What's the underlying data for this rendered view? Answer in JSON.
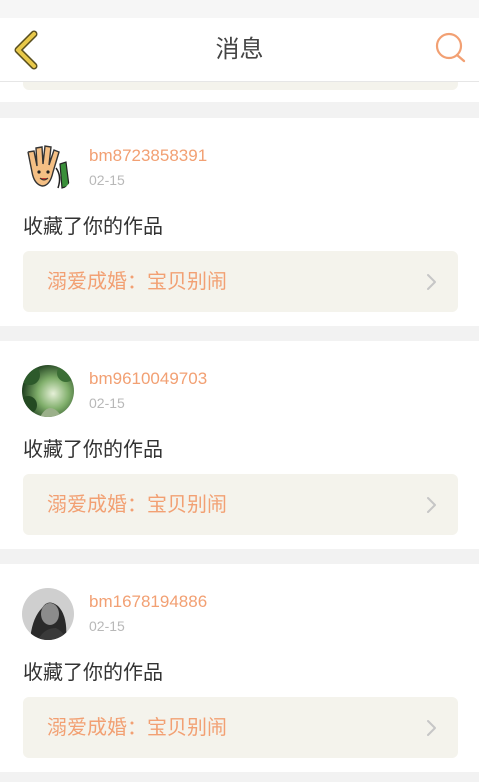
{
  "header": {
    "title": "消息",
    "back_icon": "chevron-left-icon",
    "search_icon": "search-icon",
    "accent_color": "#f2a073",
    "back_color": "#e8c84a"
  },
  "messages": [
    {
      "username": "bm8723858391",
      "date": "02-15",
      "action": "收藏了你的作品",
      "work_title": "溺爱成婚：宝贝别闹"
    },
    {
      "username": "bm9610049703",
      "date": "02-15",
      "action": "收藏了你的作品",
      "work_title": "溺爱成婚：宝贝别闹"
    },
    {
      "username": "bm1678194886",
      "date": "02-15",
      "action": "收藏了你的作品",
      "work_title": "溺爱成婚：宝贝别闹"
    }
  ]
}
